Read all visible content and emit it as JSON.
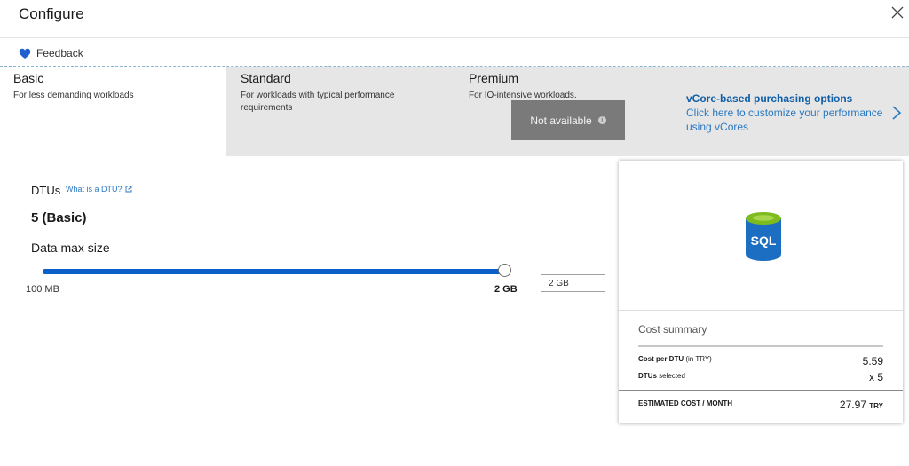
{
  "header": {
    "title": "Configure",
    "feedback_label": "Feedback"
  },
  "tiers": [
    {
      "name": "Basic",
      "description": "For less demanding workloads",
      "selected": true
    },
    {
      "name": "Standard",
      "description": "For workloads with typical performance requirements",
      "selected": false
    },
    {
      "name": "Premium",
      "description": "For IO-intensive workloads.",
      "selected": false
    }
  ],
  "premium_overlay": {
    "label": "Not available",
    "info": "i"
  },
  "vcore": {
    "title": "vCore-based purchasing options",
    "body": "Click here to customize your performance using vCores"
  },
  "dtus": {
    "label": "DTUs",
    "help_link": "What is a DTU?",
    "value": "5 (Basic)"
  },
  "data_max_size": {
    "label": "Data max size",
    "min_label": "100 MB",
    "max_label": "2 GB",
    "slider_fraction": 1.0,
    "input_value": "2 GB"
  },
  "cost_summary": {
    "icon_text": "SQL",
    "title": "Cost summary",
    "rows": [
      {
        "label_bold": "Cost per DTU",
        "label_rest": " (in TRY)",
        "value": "5.59"
      },
      {
        "label_bold": "DTUs",
        "label_rest": " selected",
        "value": "x 5"
      }
    ],
    "estimated_label": "ESTIMATED COST / MONTH",
    "estimated_value": "27.97",
    "currency": "TRY"
  },
  "colors": {
    "accent": "#0a60c8",
    "link": "#2b79c2",
    "heart": "#1f5fd0",
    "sql_blue": "#1b6ec2",
    "sql_green": "#7dbb1e"
  }
}
